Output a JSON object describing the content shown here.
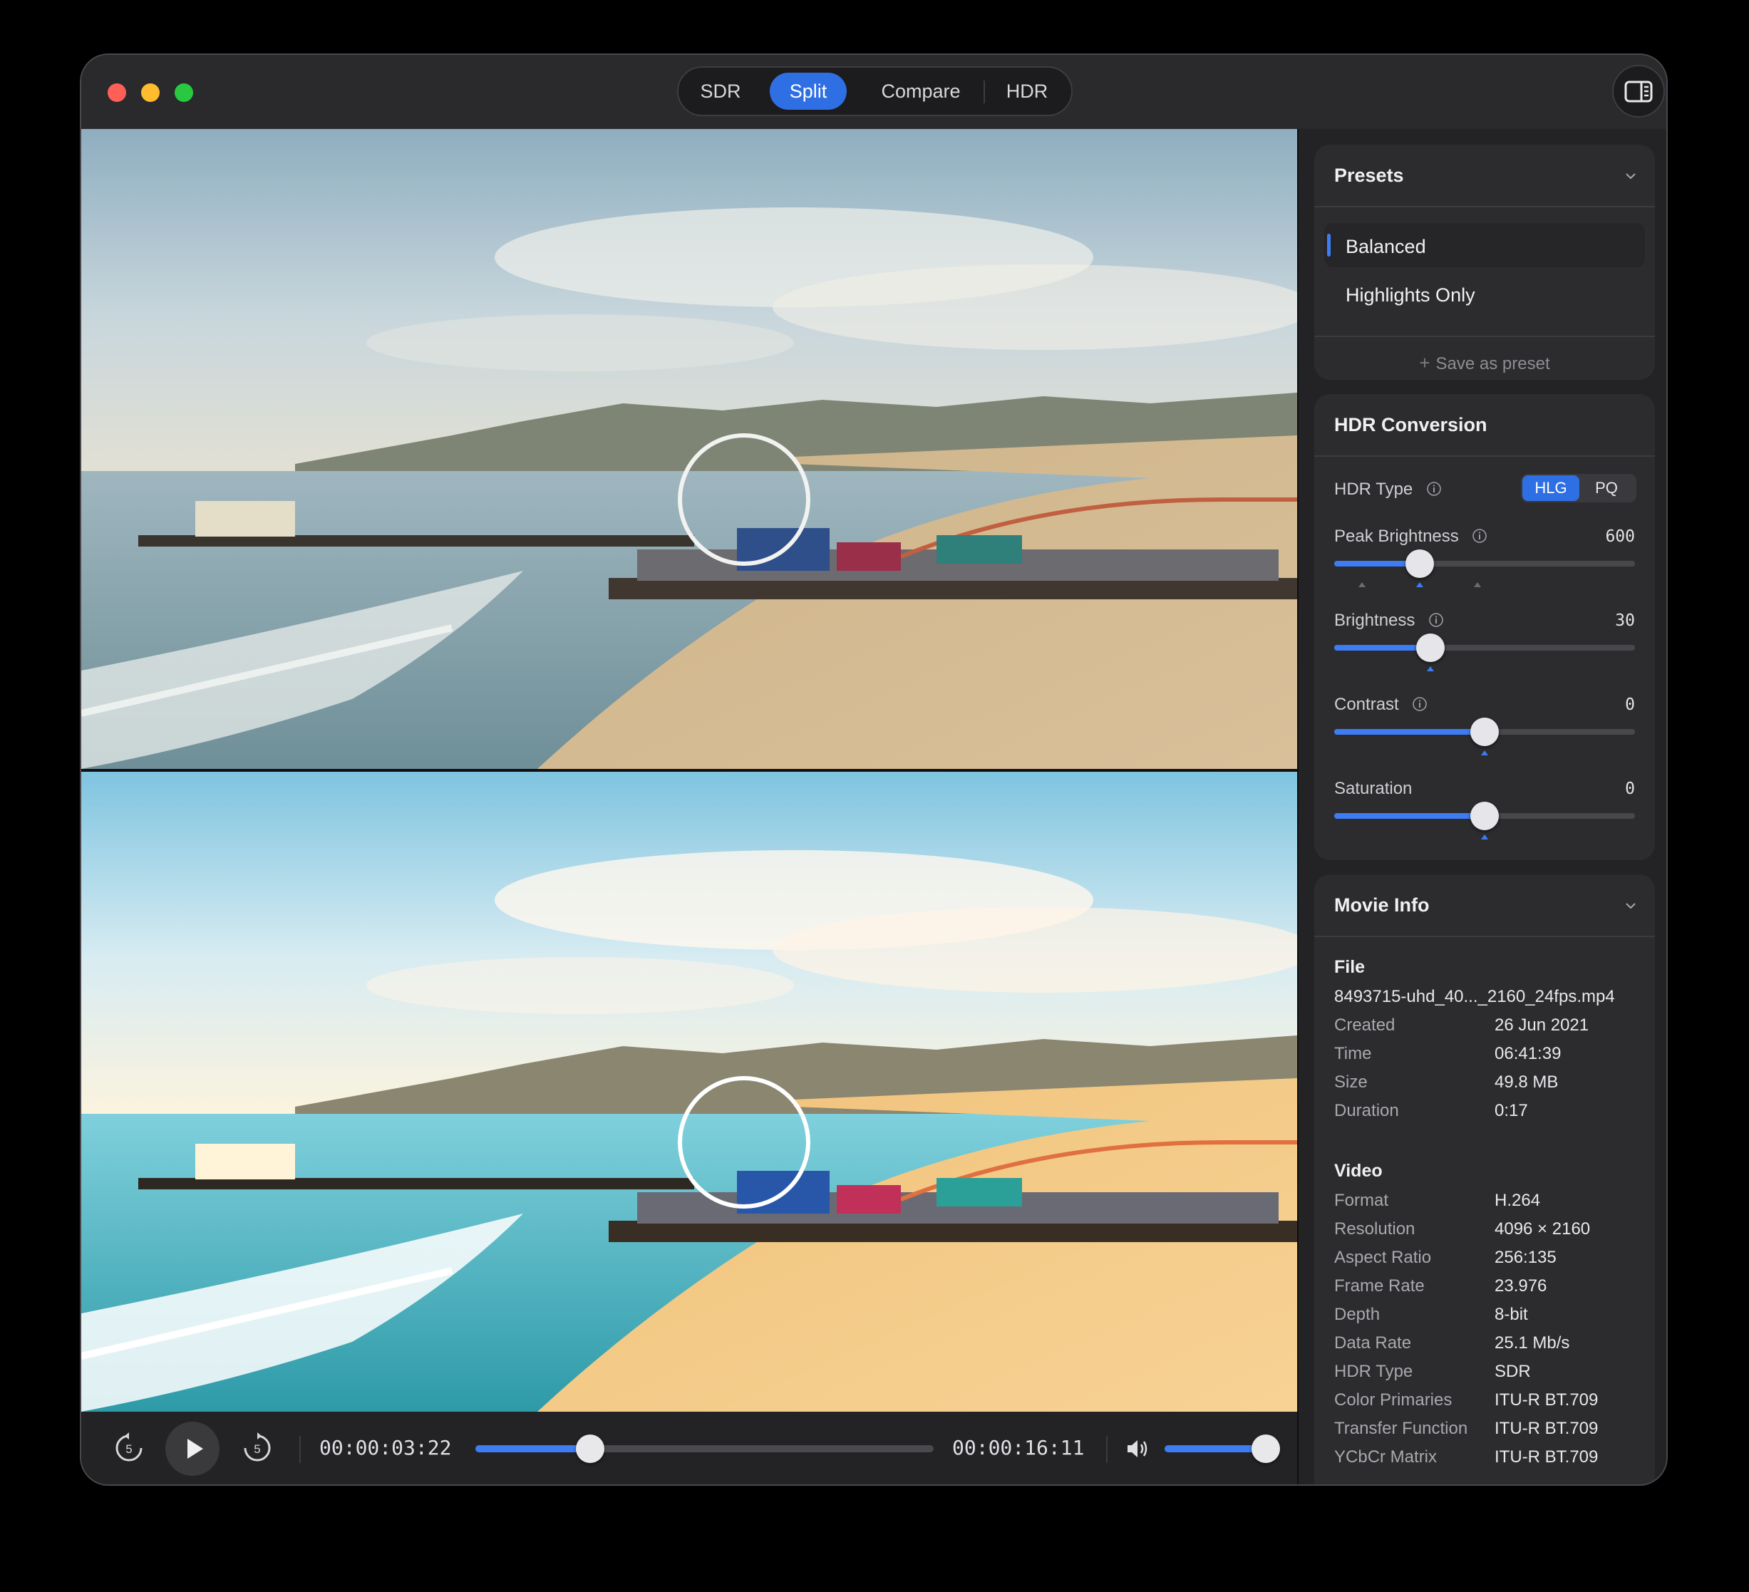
{
  "view_modes": {
    "sdr": "SDR",
    "split": "Split",
    "compare": "Compare",
    "hdr": "HDR",
    "selected": "Split"
  },
  "player": {
    "skip_back_seconds": "5",
    "skip_forward_seconds": "5",
    "current_time": "00:00:03:22",
    "remaining_time": "00:00:16:11",
    "progress_fraction": 0.25,
    "volume_fraction": 1.0
  },
  "presets": {
    "title": "Presets",
    "items": [
      {
        "label": "Balanced",
        "selected": true
      },
      {
        "label": "Highlights Only",
        "selected": false
      }
    ],
    "save_label": "Save as preset"
  },
  "hdr_conversion": {
    "title": "HDR Conversion",
    "hdr_type_label": "HDR Type",
    "hdr_type_options": [
      "HLG",
      "PQ"
    ],
    "hdr_type_selected": "HLG",
    "peak_brightness": {
      "label": "Peak Brightness",
      "value": "600",
      "fraction": 0.285
    },
    "brightness": {
      "label": "Brightness",
      "value": "30",
      "fraction": 0.32
    },
    "contrast": {
      "label": "Contrast",
      "value": "0",
      "fraction": 0.5
    },
    "saturation": {
      "label": "Saturation",
      "value": "0",
      "fraction": 0.5
    }
  },
  "movie_info": {
    "title": "Movie Info",
    "file_heading": "File",
    "file_name": "8493715-uhd_40..._2160_24fps.mp4",
    "file_rows": [
      {
        "key": "Created",
        "value": "26 Jun 2021"
      },
      {
        "key": "Time",
        "value": "06:41:39"
      },
      {
        "key": "Size",
        "value": "49.8 MB"
      },
      {
        "key": "Duration",
        "value": "0:17"
      }
    ],
    "video_heading": "Video",
    "video_rows": [
      {
        "key": "Format",
        "value": "H.264"
      },
      {
        "key": "Resolution",
        "value": "4096 × 2160"
      },
      {
        "key": "Aspect Ratio",
        "value": "256:135"
      },
      {
        "key": "Frame Rate",
        "value": "23.976"
      },
      {
        "key": "Depth",
        "value": "8-bit"
      },
      {
        "key": "Data Rate",
        "value": "25.1 Mb/s"
      },
      {
        "key": "HDR Type",
        "value": "SDR"
      },
      {
        "key": "Color Primaries",
        "value": "ITU-R BT.709"
      },
      {
        "key": "Transfer Function",
        "value": "ITU-R BT.709"
      },
      {
        "key": "YCbCr Matrix",
        "value": "ITU-R BT.709"
      }
    ]
  },
  "colors": {
    "accent": "#2f6fe4",
    "window_bg": "#232326",
    "card_bg": "#2c2c2f"
  },
  "icons": {
    "sidebar_toggle": "sidebar-right-icon",
    "skip_back": "gobackward-5-icon",
    "play": "play-icon",
    "skip_forward": "goforward-5-icon",
    "volume": "speaker-wave-icon",
    "info": "info-circle-icon",
    "collapse": "chevron-down-icon",
    "add": "plus-icon"
  }
}
